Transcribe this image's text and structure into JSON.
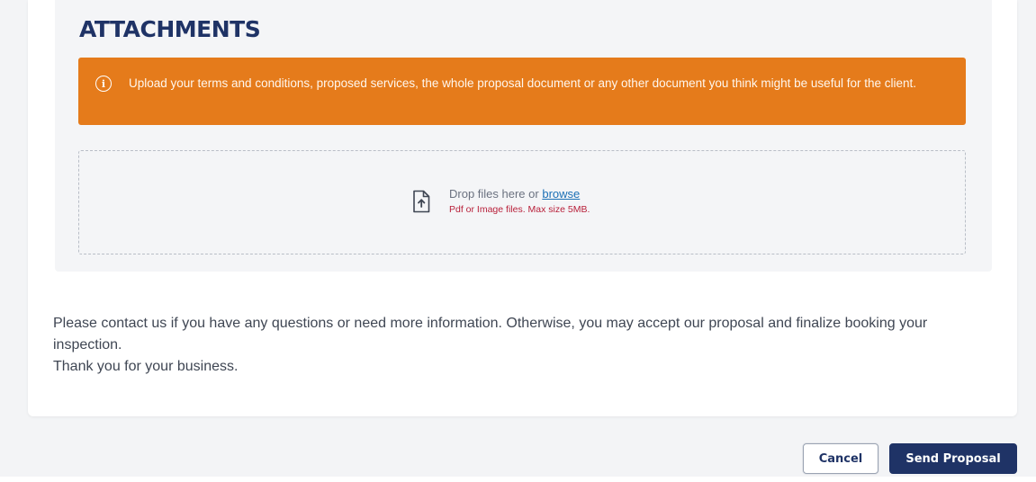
{
  "attachments": {
    "title": "ATTACHMENTS",
    "alert": {
      "icon": "info-icon",
      "icon_glyph": "i",
      "text": "Upload your terms and conditions, proposed services, the whole proposal document or any other document you think might be useful for the client."
    },
    "dropzone": {
      "icon": "file-upload-icon",
      "prompt": "Drop files here or",
      "browse_label": "browse",
      "hint": "Pdf or Image files. Max size 5MB."
    }
  },
  "closing": {
    "paragraph1": "Please contact us if you have any questions or need more information. Otherwise, you may accept our proposal and finalize booking your inspection.",
    "paragraph2": "Thank you for your business."
  },
  "actions": {
    "cancel_label": "Cancel",
    "send_label": "Send Proposal"
  },
  "colors": {
    "brand_navy": "#1f3366",
    "alert_orange": "#e57b1b",
    "hint_red": "#b8203a",
    "link_blue": "#1b6fb5"
  }
}
